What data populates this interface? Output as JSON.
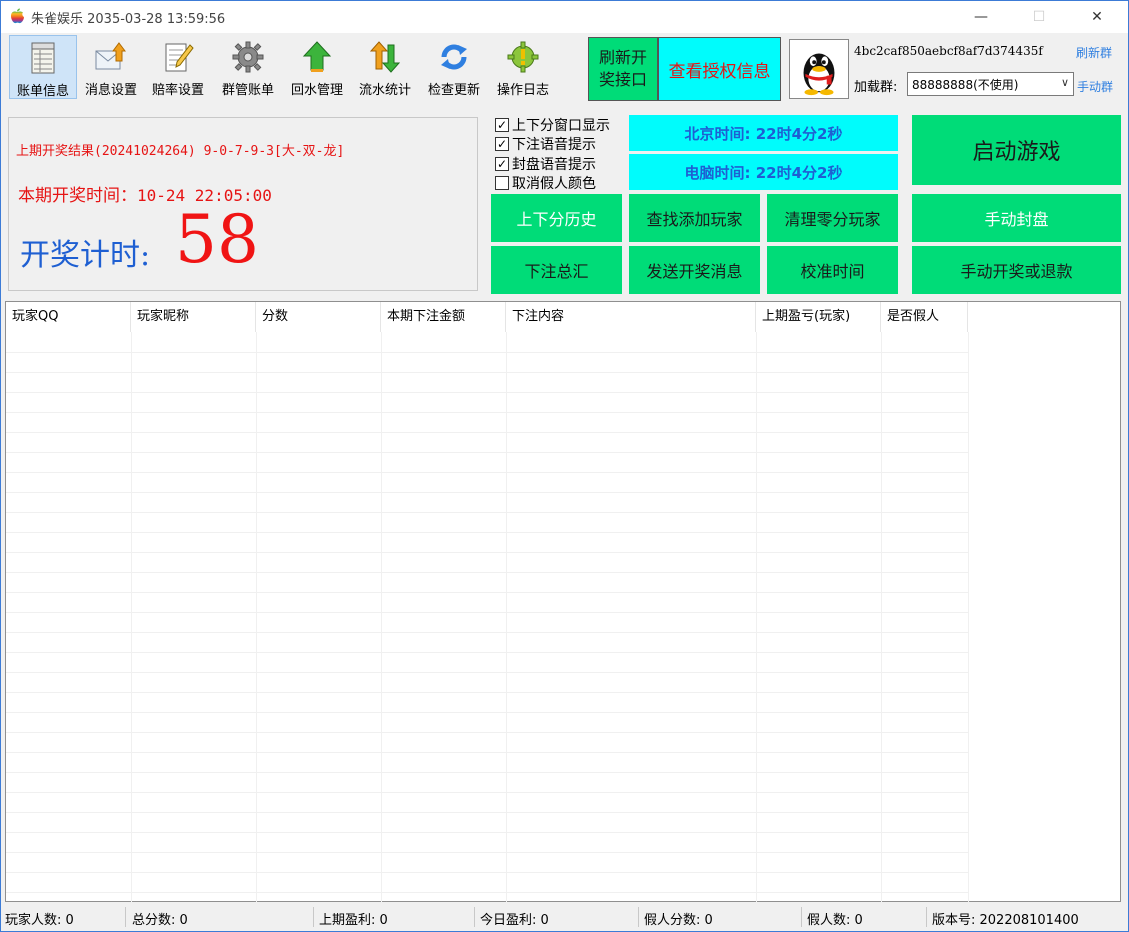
{
  "window": {
    "title": "朱雀娱乐  2035-03-28 13:59:56",
    "min_glyph": "—",
    "max_glyph": "☐",
    "close_glyph": "✕"
  },
  "toolbar": [
    {
      "label": "账单信息",
      "icon": "ledger-icon",
      "active": true
    },
    {
      "label": "消息设置",
      "icon": "envelope-icon"
    },
    {
      "label": "赔率设置",
      "icon": "notepad-icon"
    },
    {
      "label": "群管账单",
      "icon": "gear-icon"
    },
    {
      "label": "回水管理",
      "icon": "up-arrow-icon"
    },
    {
      "label": "流水统计",
      "icon": "swap-arrows-icon"
    },
    {
      "label": "检查更新",
      "icon": "refresh-icon"
    },
    {
      "label": "操作日志",
      "icon": "warning-gear-icon"
    }
  ],
  "top_actions": {
    "refresh_draw_api": "刷新开奖接口",
    "view_license": "查看授权信息"
  },
  "account": {
    "id": "4bc2caf850aebcf8af7d374435f",
    "refresh_group": "刷新群",
    "load_group_label": "加载群:",
    "group_selected": "88888888(不使用)",
    "manual_group": "手动群",
    "avatar_icon": "qq-penguin-icon"
  },
  "info": {
    "last_result": "上期开奖结果(20241024264)  9-0-7-9-3[大-双-龙]",
    "draw_time_label": "本期开奖时间：",
    "draw_time_value": "10-24  22:05:00",
    "countdown_label": "开奖计时:",
    "countdown_value": "58"
  },
  "options": [
    {
      "label": "上下分窗口显示",
      "checked": true
    },
    {
      "label": "下注语音提示",
      "checked": true
    },
    {
      "label": "封盘语音提示",
      "checked": true
    },
    {
      "label": "取消假人颜色",
      "checked": false
    }
  ],
  "clocks": {
    "beijing": "北京时间: 22时4分2秒",
    "computer": "电脑时间: 22时4分2秒"
  },
  "buttons": {
    "start_game": "启动游戏",
    "score_history": "上下分历史",
    "find_add_player": "查找添加玩家",
    "clear_zero": "清理零分玩家",
    "manual_close": "手动封盘",
    "bet_summary": "下注总汇",
    "send_draw_msg": "发送开奖消息",
    "calibrate_time": "校准时间",
    "manual_draw_refund": "手动开奖或退款"
  },
  "grid": {
    "columns": [
      "玩家QQ",
      "玩家昵称",
      "分数",
      "本期下注金额",
      "下注内容",
      "上期盈亏(玩家)",
      "是否假人"
    ],
    "rows": []
  },
  "status": {
    "players": "玩家人数: 0",
    "total_score": "总分数: 0",
    "last_profit": "上期盈利: 0",
    "today_profit": "今日盈利: 0",
    "fake_score": "假人分数: 0",
    "fake_count": "假人数: 0",
    "version": "版本号: 202208101400"
  },
  "colors": {
    "accent_green": "#00dc78",
    "cyan": "#00fcfc",
    "red_text": "#e61414",
    "blue_text": "#1e5fd2"
  }
}
